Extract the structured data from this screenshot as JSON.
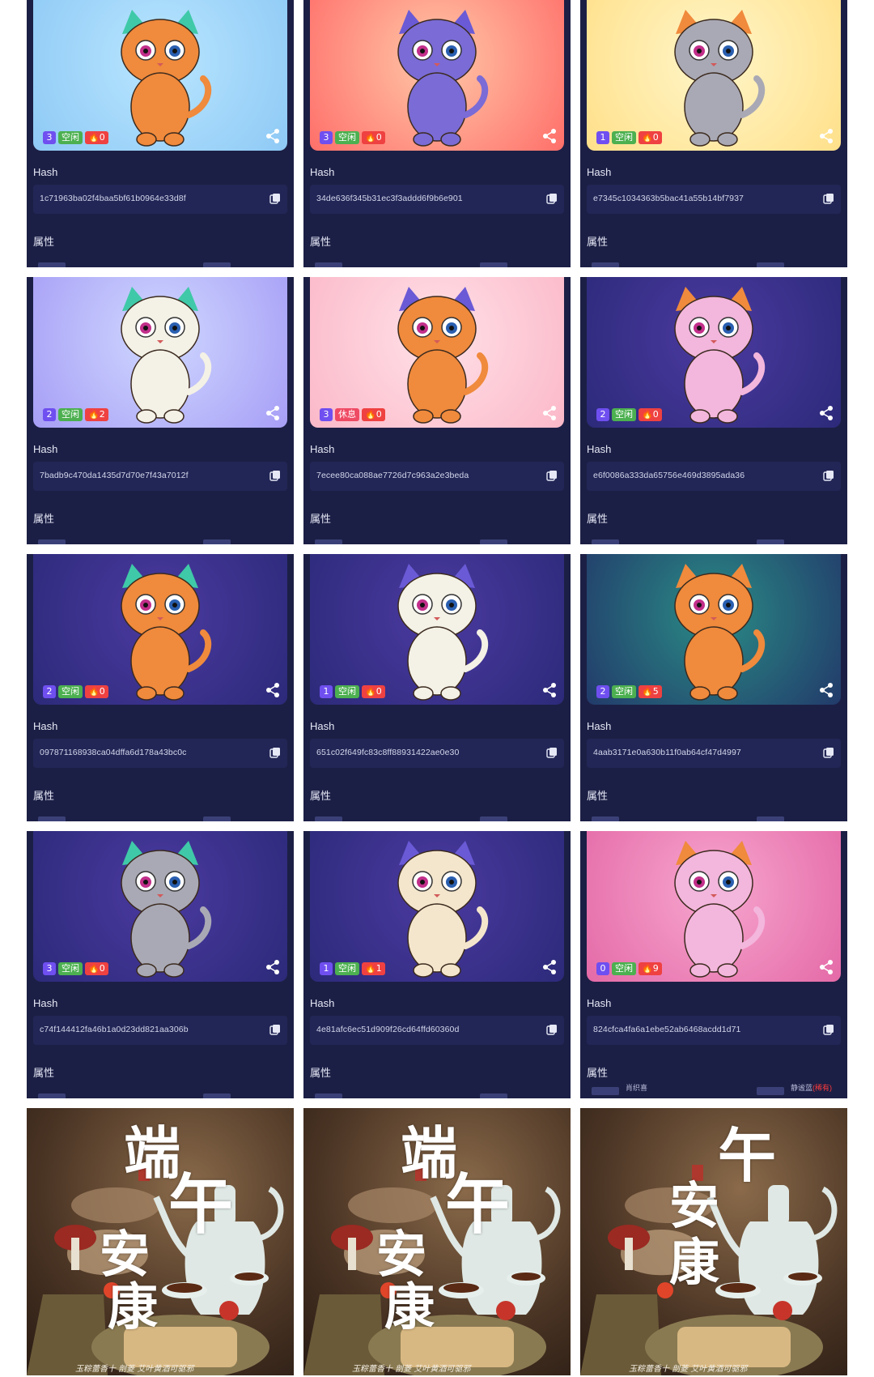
{
  "labels": {
    "hash": "Hash",
    "attributes": "属性"
  },
  "status": {
    "idle": "空闲",
    "rest": "休息"
  },
  "cards": [
    {
      "gen": "3",
      "status": "空闲",
      "likes": "0",
      "hash": "1c71963ba02f4baa5bf61b0964e33d8f",
      "bg": [
        "#b9e6ff",
        "#8ec9f5"
      ],
      "body": "#f08a3c",
      "attrs": [
        "",
        "",
        ""
      ]
    },
    {
      "gen": "3",
      "status": "空闲",
      "likes": "0",
      "hash": "34de636f345b31ec3f3addd6f9b6e901",
      "bg": [
        "#ffc8a8",
        "#ff6f6a"
      ],
      "body": "#7a6bd6",
      "attrs": [
        "",
        "",
        ""
      ]
    },
    {
      "gen": "1",
      "status": "空闲",
      "likes": "0",
      "hash": "e7345c1034363b5bac41a55b14bf7937",
      "bg": [
        "#fff6c9",
        "#ffe08a"
      ],
      "body": "#a9a9b5",
      "attrs": [
        "",
        "",
        ""
      ]
    },
    {
      "gen": "2",
      "status": "空闲",
      "likes": "2",
      "hash": "7badb9c470da1435d7d70e7f43a7012f",
      "bg": [
        "#cfd8ff",
        "#a79ef6"
      ],
      "body": "#f4f1e6",
      "attrs": [
        "",
        "",
        ""
      ]
    },
    {
      "gen": "3",
      "status": "休息",
      "likes": "0",
      "hash": "7ecee80ca088ae7726d7c963a2e3beda",
      "bg": [
        "#ffe1e8",
        "#fbb8c8"
      ],
      "body": "#f08a3c",
      "attrs": [
        "",
        "",
        ""
      ]
    },
    {
      "gen": "2",
      "status": "空闲",
      "likes": "0",
      "hash": "e6f0086a333da65756e469d3895ada36",
      "bg": [
        "#4b3aa0",
        "#2c2a7a"
      ],
      "body": "#f3b6dc",
      "attrs": [
        "",
        "",
        ""
      ]
    },
    {
      "gen": "2",
      "status": "空闲",
      "likes": "0",
      "hash": "097871168938ca04dffa6d178a43bc0c",
      "bg": [
        "#4b3aa0",
        "#2c2a7a"
      ],
      "body": "#f08a3c",
      "attrs": [
        "",
        "",
        ""
      ]
    },
    {
      "gen": "1",
      "status": "空闲",
      "likes": "0",
      "hash": "651c02f649fc83c8ff88931422ae0e30",
      "bg": [
        "#4b3aa0",
        "#2c2a7a"
      ],
      "body": "#f4f1e6",
      "attrs": [
        "",
        "",
        ""
      ]
    },
    {
      "gen": "2",
      "status": "空闲",
      "likes": "5",
      "hash": "4aab3171e0a630b11f0ab64cf47d4997",
      "bg": [
        "#2a8c86",
        "#223a6a"
      ],
      "body": "#f08a3c",
      "attrs": [
        "",
        "",
        ""
      ]
    },
    {
      "gen": "3",
      "status": "空闲",
      "likes": "0",
      "hash": "c74f144412fa46b1a0d23dd821aa306b",
      "bg": [
        "#4b3aa0",
        "#2c2a7a"
      ],
      "body": "#a9a9b5",
      "attrs": [
        "",
        "",
        ""
      ]
    },
    {
      "gen": "1",
      "status": "空闲",
      "likes": "1",
      "hash": "4e81afc6ec51d909f26cd64ffd60360d",
      "bg": [
        "#4b3aa0",
        "#2c2a7a"
      ],
      "body": "#f4e6cc",
      "attrs": [
        "",
        "",
        ""
      ]
    },
    {
      "gen": "0",
      "status": "空闲",
      "likes": "9",
      "hash": "824cfca4fa6a1ebe52ab6468acdd1d71",
      "bg": [
        "#f7a6cf",
        "#e46aa7"
      ],
      "body": "#f3b6dc",
      "attrs": [
        "",
        "",
        ""
      ]
    }
  ],
  "last_card_attrs": {
    "left": "肖织喜",
    "right": "静谧蓝",
    "right_tag": "(稀有)"
  },
  "posters": [
    {
      "chars": [
        "端",
        "午",
        "安",
        "康"
      ],
      "tagline": "玉粽蕾香十 剖菱 艾叶黄酒可驱邪"
    },
    {
      "chars": [
        "端",
        "午",
        "安",
        "康"
      ],
      "tagline": "玉粽蕾香十 剖菱 艾叶黄酒可驱邪"
    },
    {
      "chars": [
        "午",
        "安",
        "康"
      ],
      "tagline": "玉粽蕾香十 剖菱 艾叶黄酒可驱邪"
    }
  ]
}
